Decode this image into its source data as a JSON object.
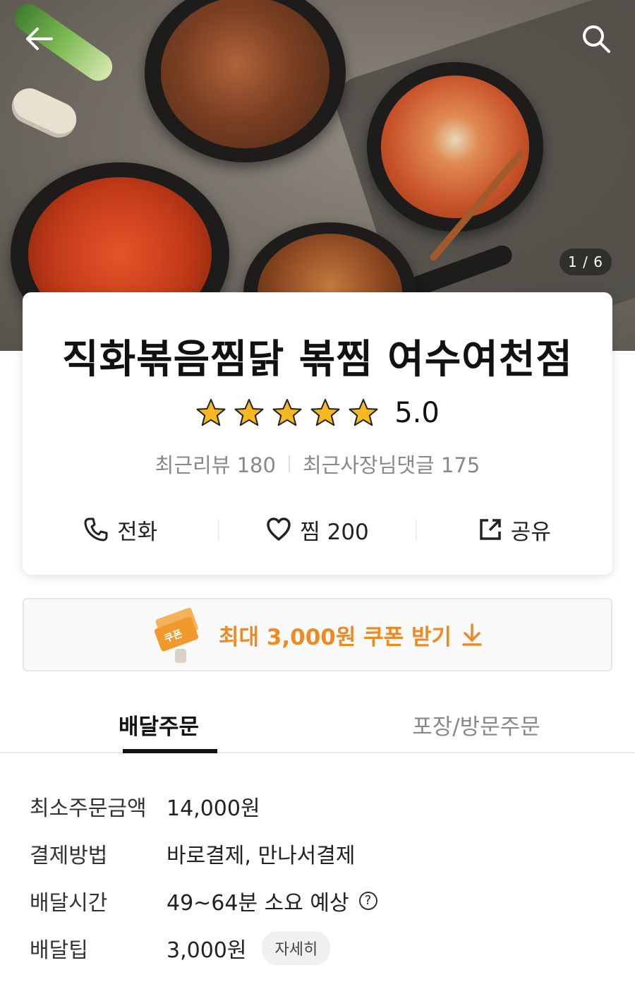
{
  "hero": {
    "page_counter": "1 / 6",
    "icons": {
      "back": "back-arrow-icon",
      "search": "search-icon"
    }
  },
  "store": {
    "name": "직화볶음찜닭 볶찜 여수여천점",
    "rating": {
      "value": 5.0,
      "display": "5.0",
      "max": 5,
      "star_color": "#f6b820"
    },
    "reviews": {
      "recent_reviews": "최근리뷰 180",
      "owner_replies": "최근사장님댓글 175"
    },
    "actions": [
      {
        "label": "전화",
        "icon": "phone-icon"
      },
      {
        "label": "찜 200",
        "icon": "heart-icon"
      },
      {
        "label": "공유",
        "icon": "share-icon"
      }
    ]
  },
  "coupon": {
    "label": "최대 3,000원 쿠폰 받기",
    "icon": "coupon-ticket-icon",
    "accent_color": "#ef8a23"
  },
  "tabs": [
    {
      "label": "배달주문",
      "active": true
    },
    {
      "label": "포장/방문주문",
      "active": false
    }
  ],
  "info": {
    "min_order": {
      "label": "최소주문금액",
      "value": "14,000원"
    },
    "payment": {
      "label": "결제방법",
      "value": "바로결제, 만나서결제"
    },
    "delivery_time": {
      "label": "배달시간",
      "value": "49~64분 소요 예상",
      "help": "?"
    },
    "delivery_tip": {
      "label": "배달팁",
      "value": "3,000원",
      "detail_button": "자세히"
    }
  }
}
